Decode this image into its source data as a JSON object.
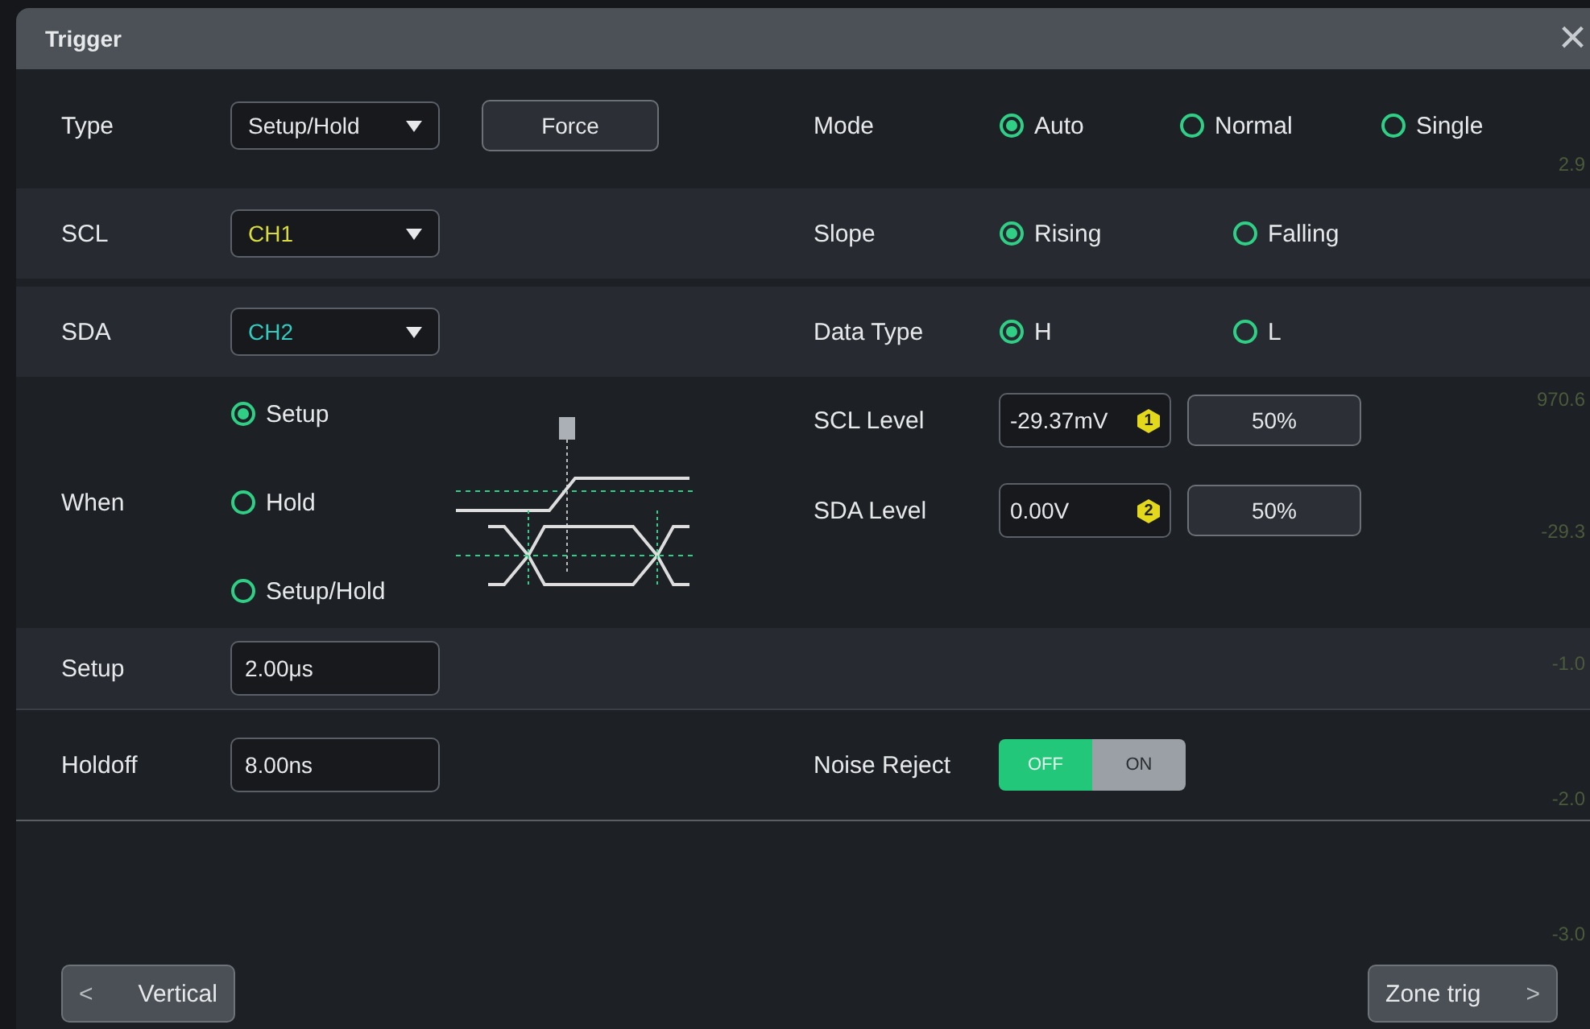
{
  "window": {
    "title": "Trigger",
    "close": "×"
  },
  "type_row": {
    "label": "Type",
    "value": "Setup/Hold",
    "force_button": "Force"
  },
  "mode": {
    "label": "Mode",
    "options": [
      {
        "label": "Auto",
        "selected": true
      },
      {
        "label": "Normal",
        "selected": false
      },
      {
        "label": "Single",
        "selected": false
      }
    ]
  },
  "source_rows": [
    {
      "label": "SCL",
      "source": "CH1",
      "color": "#d8dc3c",
      "option_label": "Slope",
      "options": [
        {
          "label": "Rising",
          "selected": true
        },
        {
          "label": "Falling",
          "selected": false
        }
      ]
    },
    {
      "label": "SDA",
      "source": "CH2",
      "color": "#33cbbf",
      "option_label": "Data Type",
      "options": [
        {
          "label": "H",
          "selected": true
        },
        {
          "label": "L",
          "selected": false
        }
      ]
    }
  ],
  "when": {
    "label": "When",
    "options": [
      {
        "label": "Setup",
        "selected": true
      },
      {
        "label": "Hold",
        "selected": false
      },
      {
        "label": "Setup/Hold",
        "selected": false
      }
    ]
  },
  "levels": [
    {
      "label": "SCL Level",
      "value": "-29.37mV",
      "badge": "1",
      "button": "50%"
    },
    {
      "label": "SDA Level",
      "value": "0.00V",
      "badge": "2",
      "button": "50%"
    }
  ],
  "setup": {
    "label": "Setup",
    "value": "2.00μs"
  },
  "holdoff": {
    "label": "Holdoff",
    "value": "8.00ns"
  },
  "noise_reject": {
    "label": "Noise Reject",
    "off_label": "OFF",
    "on_label": "ON",
    "on": false
  },
  "nav": {
    "prev_glyph": "<",
    "prev": "Vertical",
    "next": "Zone trig",
    "next_glyph": ">"
  },
  "background_labels": [
    "2.9",
    "970.6",
    "-29.3",
    "-1.0",
    "-2.0",
    "-3.0"
  ]
}
